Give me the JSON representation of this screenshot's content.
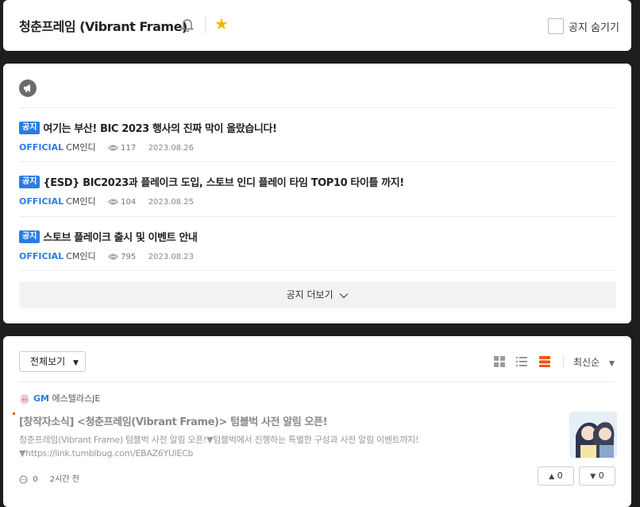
{
  "header": {
    "title": "청춘프레임 (Vibrant Frame)",
    "hide_notice_label": "공지 숨기기"
  },
  "notices": {
    "items": [
      {
        "badge": "공지",
        "title": "여기는 부산! BIC 2023 행사의 진짜 막이 올랐습니다!",
        "official": "OFFICIAL",
        "author": "CM인디",
        "views": "117",
        "date": "2023.08.26"
      },
      {
        "badge": "공지",
        "title": "{ESD} BIC2023과 플레이크 도입, 스토브 인디 플레이 타임 TOP10 타이틀 까지!",
        "official": "OFFICIAL",
        "author": "CM인디",
        "views": "104",
        "date": "2023.08.25"
      },
      {
        "badge": "공지",
        "title": "스토브 플레이크 출시 및 이벤트 안내",
        "official": "OFFICIAL",
        "author": "CM인디",
        "views": "795",
        "date": "2023.08.23"
      }
    ],
    "more_label": "공지 더보기"
  },
  "posts": {
    "filter_label": "전체보기",
    "sort_label": "최신순",
    "items": [
      {
        "author_tag": "GM",
        "author": "에스텔라스JE",
        "title": "[창작자소식] <청춘프레임(Vibrant Frame)> 텀블벅 사전 알림 오픈!",
        "body_line1": "청춘프레임(Vibrant Frame) 텀블벅 사전 알림 오픈!▼텀블벅에서 진행하는 특별한 구성과 사전 알림 이벤트까지!",
        "body_line2": "▼https://link.tumblbug.com/EBAZ6YUlECb",
        "comments": "0",
        "time": "2시간 전",
        "upvotes": "0",
        "downvotes": "0"
      }
    ]
  },
  "colors": {
    "accent": "#2b7ce5",
    "star": "#f5b400",
    "active_view": "#e8591a",
    "background": "#1e1e1e"
  }
}
